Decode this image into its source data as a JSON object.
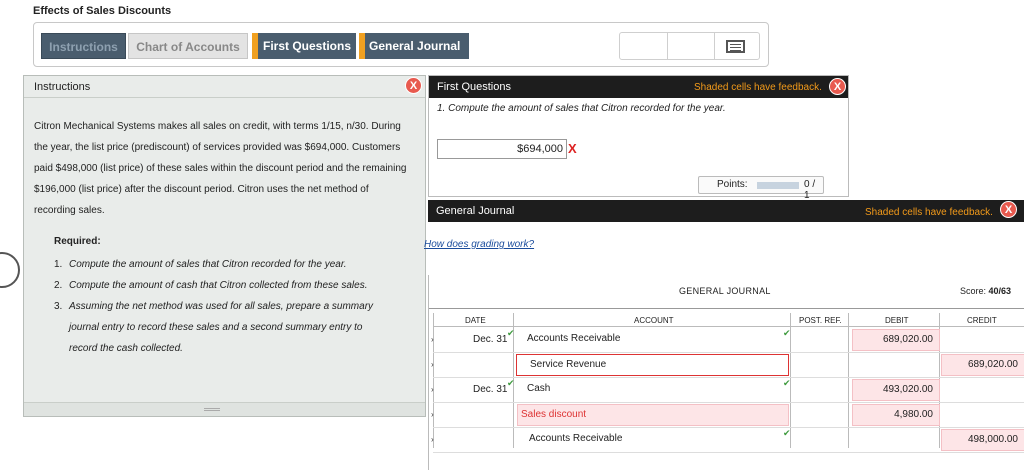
{
  "page_title": "Effects of Sales Discounts",
  "tabs": [
    {
      "label": "Instructions"
    },
    {
      "label": "Chart of Accounts"
    },
    {
      "label": "First Questions"
    },
    {
      "label": "General Journal"
    }
  ],
  "instructions": {
    "header": "Instructions",
    "close_glyph": "X",
    "body_lines": [
      "Citron Mechanical Systems makes all sales on credit, with terms 1/15, n/30. During",
      "the year, the list price (prediscount) of services provided was $694,000. Customers",
      "paid $498,000 (list price) of these sales within the discount period and the remaining",
      "$196,000 (list price) after the discount period. Citron uses the net method of",
      "recording sales."
    ],
    "required_label": "Required:",
    "required_items": [
      {
        "num": "1.",
        "text": "Compute the amount of sales that Citron recorded for the year."
      },
      {
        "num": "2.",
        "text": "Compute the amount of cash that Citron collected from these sales."
      },
      {
        "num": "3.",
        "text": "Assuming the net method was used for all sales, prepare a summary",
        "cont": [
          "journal entry to record these sales and a second summary entry to",
          "record the cash collected."
        ]
      }
    ]
  },
  "first_questions": {
    "header": "First Questions",
    "feedback_note": "Shaded cells have feedback.",
    "close_glyph": "X",
    "question": "1. Compute the amount of sales that Citron recorded for the year.",
    "answer_value": "$694,000",
    "answer_mark": "X",
    "points_label": "Points:",
    "points_value": "0 / 1",
    "points_fraction": 0
  },
  "general_journal": {
    "header": "General Journal",
    "feedback_note": "Shaded cells have feedback.",
    "close_glyph": "X",
    "help_link": "How does grading work?",
    "title": "GENERAL JOURNAL",
    "score_label": "Score:",
    "score_value": "40/63",
    "columns": {
      "date": "DATE",
      "account": "ACCOUNT",
      "post_ref": "POST. REF.",
      "debit": "DEBIT",
      "credit": "CREDIT"
    },
    "rows": [
      {
        "date": "Dec. 31",
        "account": "Accounts Receivable",
        "debit": "689,020.00",
        "credit": ""
      },
      {
        "date": "",
        "account": "Service Revenue",
        "debit": "",
        "credit": "689,020.00"
      },
      {
        "date": "Dec. 31",
        "account": "Cash",
        "debit": "493,020.00",
        "credit": ""
      },
      {
        "date": "",
        "account": "Sales discount",
        "debit": "4,980.00",
        "credit": ""
      },
      {
        "date": "",
        "account": "Accounts Receivable",
        "debit": "",
        "credit": "498,000.00"
      }
    ]
  },
  "colors": {
    "tab_dark": "#4a5d6e",
    "alert_orange": "#f0a020",
    "feedback_red": "#e85a4f",
    "pink_cell": "#fde5e7",
    "check_green": "#3c9a3c"
  }
}
